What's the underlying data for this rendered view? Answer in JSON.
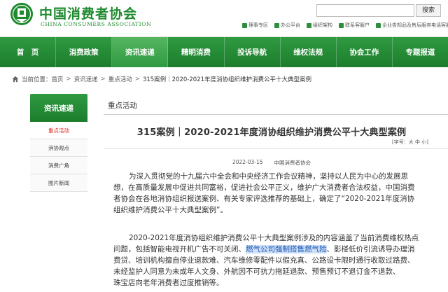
{
  "header": {
    "logo_cn": "中国消费者协会",
    "logo_en": "CHINA CONSUMERS ASSOCIATION",
    "search_button": "搜索",
    "search_value": "",
    "toplinks": [
      "理事专区",
      "办公平台",
      "组织架构",
      "加入了解消协",
      "联系客服户",
      "企业告知品及售后服务",
      "电话客服"
    ]
  },
  "nav": {
    "items": [
      "首　页",
      "消费政策",
      "资讯速递",
      "精明消费",
      "投诉导航",
      "维权法规",
      "协会工作",
      "专题报道"
    ],
    "active_index": 2
  },
  "breadcrumb": {
    "prefix": "当前位置：",
    "items": [
      "首页",
      "资讯速递",
      "重点活动"
    ],
    "current": "315案例｜2020-2021年度消协组织维护消费公平十大典型案例",
    "separator": ">"
  },
  "sidebar": {
    "title": "资讯速递",
    "items": [
      "重点活动",
      "消协观点",
      "消费广角",
      "图片新闻"
    ],
    "active_index": 0
  },
  "section": {
    "title": "重点活动"
  },
  "article": {
    "title": "315案例｜2020-2021年度消协组织维护消费公平十大典型案例",
    "fontsize_prefix": "[字号：",
    "fontsize_large": "大",
    "fontsize_medium": "中",
    "fontsize_small": "小",
    "fontsize_suffix": "]",
    "date": "2022-03-15",
    "source": "中国消费者协会",
    "para1_lines": [
      "为深入贯彻党的十九届六中全会和中央经济工作会议精神，坚持以人民为中心的发展思",
      "想，在高质量发展中促进共同富裕，促进社会公平正义，维护广大消费者合法权益，中国消费",
      "者协会在各地消协组织报送案例、有关专家评选推荐的基础上，确定了“2020-2021年度消协",
      "组织维护消费公平十大典型案例”。"
    ],
    "para2_line1": "2020-2021年度消协组织维护消费公平十大典型案例涉及的内容涵盖了当前消费维权热点",
    "para2_line2_before": "问题，包括智能电视开机广告不可关闭、",
    "para2_highlight": "燃气公司强制搭售燃气险",
    "para2_line2_after": "、影楼低价引流诱导办理消",
    "para2_lines_rest": [
      "费贷、培训机构擅自停业退款难、汽车维修零配件以假充真、公路设卡限时通行收取过路费、",
      "未经监护人同意为未成年人文身、外航因不可抗力拖延退款、预售预订不退订金不退款、",
      "珠宝店向老年消费者过度推销等。"
    ]
  },
  "colors": {
    "brand_green": "#1f8a2e",
    "nav_green": "#2f9a41",
    "active_red": "#d8261c",
    "highlight_bg": "#cfe0f7"
  }
}
